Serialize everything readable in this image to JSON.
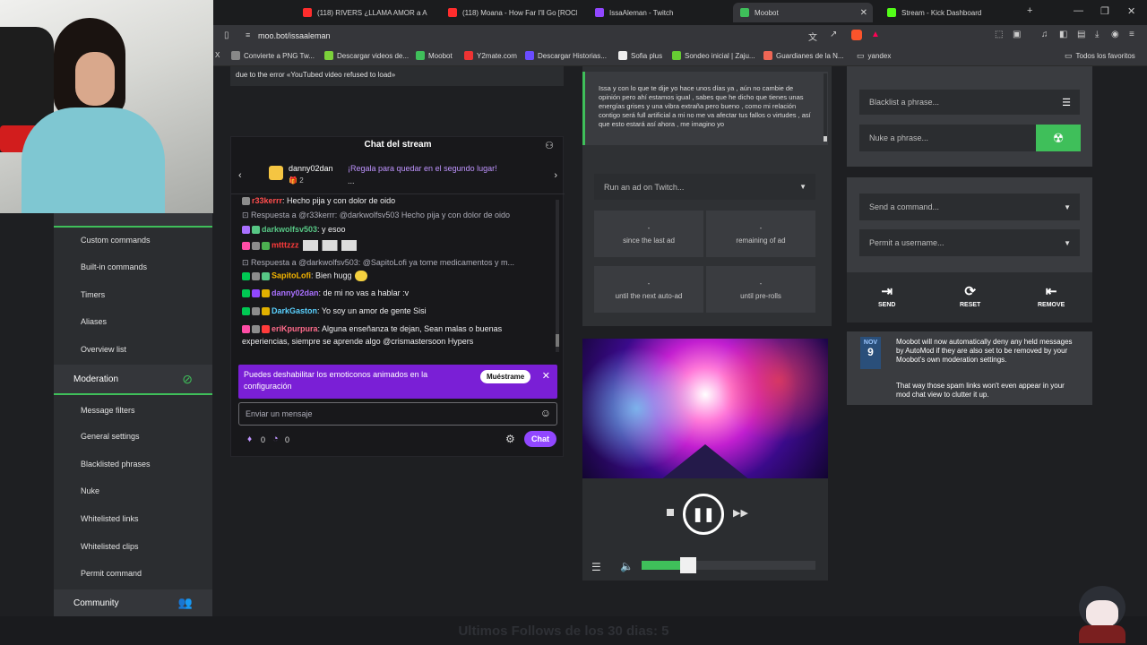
{
  "browser": {
    "tabs": [
      {
        "label": "(118) RIVERS ¿LLAMA AMOR a A",
        "color": "#ff2d2d"
      },
      {
        "label": "(118) Moana - How Far I'll Go [ROCK",
        "color": "#ff2d2d"
      },
      {
        "label": "IssaAleman - Twitch",
        "color": "#9147ff"
      },
      {
        "label": "Moobot",
        "color": "#3fbf5a"
      },
      {
        "label": "Stream - Kick Dashboard",
        "color": "#53fc18"
      }
    ],
    "url": "moo.bot/issaaleman",
    "bookmarks": [
      "Convierte a PNG Tw...",
      "Descargar videos de...",
      "Moobot",
      "Y2mate.com",
      "Descargar Historias...",
      "Sofia plus",
      "Sondeo inicial | Zaju...",
      "Guardianes de la N...",
      "yandex",
      "Todos los favoritos"
    ]
  },
  "sidebar": {
    "items_a": [
      "Custom commands",
      "Built-in commands",
      "Timers",
      "Aliases",
      "Overview list"
    ],
    "section_moderation": "Moderation",
    "items_b": [
      "Message filters",
      "General settings",
      "Blacklisted phrases",
      "Nuke",
      "Whitelisted links",
      "Whitelisted clips",
      "Permit command"
    ],
    "section_community": "Community"
  },
  "error_text": "due to the error «YouTubed video refused to load»",
  "chat": {
    "title": "Chat del stream",
    "gift_user": "danny02dan",
    "gift_count": "2",
    "gift_text": "¡Regala para quedar en el segundo lugar!",
    "gift_more": "...",
    "lines": [
      {
        "user": "r33kerrr",
        "user_color": "#ff4d4d",
        "msg": ": Hecho pija y con dolor de oido"
      },
      {
        "reply": "Respuesta a @r33kerrr: @darkwolfsv503 Hecho pija y con dolor de oido"
      },
      {
        "user": "darkwolfsv503",
        "user_color": "#57c785",
        "msg": ": y esoo"
      },
      {
        "user": "mtttzzz",
        "user_color": "#ff3b3b",
        "msg": ""
      },
      {
        "reply": "Respuesta a @darkwolfsv503: @SapitoLofi ya tome medicamentos y m..."
      },
      {
        "user": "SapitoLofi",
        "user_color": "#f4b400",
        "msg": ": Bien hugg"
      },
      {
        "user": "danny02dan",
        "user_color": "#a970ff",
        "msg": ": de mi no vas a hablar :v"
      },
      {
        "user": "DarkGaston",
        "user_color": "#5ad1ff",
        "msg": ": Yo soy un amor de gente Sisi"
      },
      {
        "user": "eriKpurpura",
        "user_color": "#ff6b8b",
        "msg": ": Alguna enseñanza te dejan, Sean malas o buenas"
      },
      {
        "msg2": "experiencias, siempre se aprende algo @crismastersoon Hypers"
      }
    ],
    "notice": "Puedes deshabilitar los emoticonos animados en la configuración",
    "notice_button": "Muéstrame",
    "input_placeholder": "Enviar un mensaje",
    "points_a": "0",
    "points_b": "0",
    "send_button": "Chat"
  },
  "quote": "Issa y con lo que te dije yo hace unos días ya , aún no cambie de opinión pero ahí estamos igual , sabes que he dicho que tienes unas energías grises y una vibra extraña pero bueno , como mi relación contigo será full artificial a mi no me va afectar tus fallos o virtudes , así que esto estará así ahora , me imagino yo",
  "ads": {
    "select_label": "Run an ad on Twitch...",
    "stats": [
      {
        "value": "-",
        "label": "since the last ad"
      },
      {
        "value": "-",
        "label": "remaining of ad"
      },
      {
        "value": "-",
        "label": "until the next auto-ad"
      },
      {
        "value": "-",
        "label": "until pre-rolls"
      }
    ]
  },
  "player": {
    "volume": 0.27
  },
  "right": {
    "blacklist_placeholder": "Blacklist a phrase...",
    "nuke_placeholder": "Nuke a phrase...",
    "command_placeholder": "Send a command...",
    "permit_placeholder": "Permit a username...",
    "actions": [
      "SEND",
      "RESET",
      "REMOVE"
    ],
    "news": {
      "month": "NOV",
      "day": "9",
      "p1": "Moobot will now automatically deny any held messages by AutoMod if they are also set to be removed by your Moobot's own moderation settings.",
      "p2": "That way those spam links won't even appear in your mod chat view to clutter it up."
    }
  },
  "bottom_ticker": "Ultimos Follows de los 30 dias: 5",
  "colors": {
    "accent": "#3fbf5a",
    "twitch": "#9147ff"
  }
}
